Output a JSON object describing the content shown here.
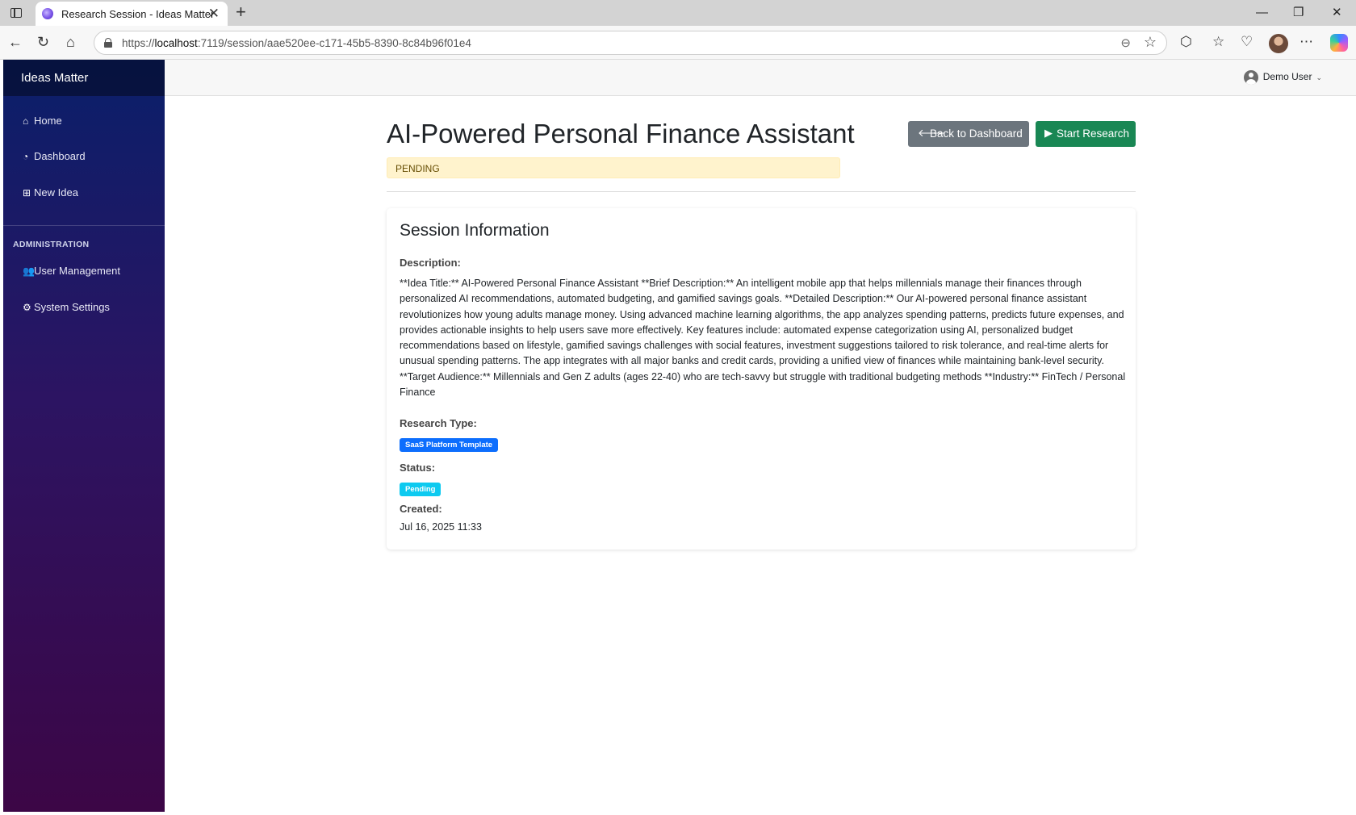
{
  "browser": {
    "tab_title": "Research Session - Ideas Matter",
    "url_scheme": "https://",
    "url_host": "localhost",
    "url_rest": ":7119/session/aae520ee-c171-45b5-8390-8c84b96f01e4"
  },
  "sidebar": {
    "brand": "Ideas Matter",
    "items": [
      {
        "label": "Home",
        "icon": "home-icon"
      },
      {
        "label": "Dashboard",
        "icon": "dashboard-icon"
      },
      {
        "label": "New Idea",
        "icon": "plus-square-icon"
      }
    ],
    "section_title": "ADMINISTRATION",
    "admin_items": [
      {
        "label": "User Management",
        "icon": "users-icon"
      },
      {
        "label": "System Settings",
        "icon": "gears-icon"
      }
    ]
  },
  "topbar": {
    "user_name": "Demo User"
  },
  "page": {
    "title": "AI-Powered Personal Finance Assistant",
    "status_alert": "PENDING",
    "back_button": "Back to Dashboard",
    "start_button": "Start Research"
  },
  "session": {
    "heading": "Session Information",
    "description_label": "Description:",
    "description": "**Idea Title:** AI-Powered Personal Finance Assistant **Brief Description:** An intelligent mobile app that helps millennials manage their finances through personalized AI recommendations, automated budgeting, and gamified savings goals. **Detailed Description:** Our AI-powered personal finance assistant revolutionizes how young adults manage money. Using advanced machine learning algorithms, the app analyzes spending patterns, predicts future expenses, and provides actionable insights to help users save more effectively. Key features include: automated expense categorization using AI, personalized budget recommendations based on lifestyle, gamified savings challenges with social features, investment suggestions tailored to risk tolerance, and real-time alerts for unusual spending patterns. The app integrates with all major banks and credit cards, providing a unified view of finances while maintaining bank-level security. **Target Audience:** Millennials and Gen Z adults (ages 22-40) who are tech-savvy but struggle with traditional budgeting methods **Industry:** FinTech / Personal Finance",
    "research_type_label": "Research Type:",
    "research_type": "SaaS Platform Template",
    "status_label": "Status:",
    "status": "Pending",
    "created_label": "Created:",
    "created": "Jul 16, 2025 11:33"
  },
  "colors": {
    "primary": "#0d6efd",
    "success": "#198754",
    "secondary": "#6c757d",
    "info": "#0dcaf0",
    "warning_bg": "#fff3cd"
  }
}
